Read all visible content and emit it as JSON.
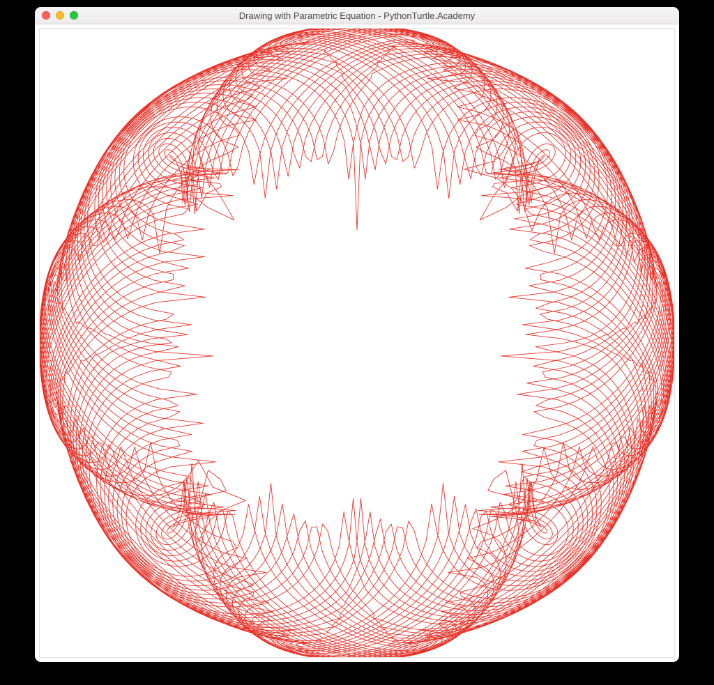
{
  "window": {
    "title": "Drawing with Parametric Equation - PythonTurtle.Academy",
    "traffic_light_colors": {
      "close": "#ff5f57",
      "minimize": "#ffbd2e",
      "zoom": "#28c940"
    }
  },
  "drawing": {
    "stroke_color": "#e8332a",
    "stroke_width": 0.9,
    "background": "#ffffff",
    "parametric": {
      "equation": "x = R * sin(t) * ( |cos(k t)|^p + c ),  y = R * cos(t) * ( |cos(k t)|^p + c )",
      "R": 300,
      "k": 2,
      "p": 0.25,
      "c": 0.55,
      "x_freq_offset": 0.045,
      "y_freq_offset": -0.045,
      "t_start": 0,
      "t_end_cycles": 44,
      "points_per_cycle": 360
    }
  }
}
